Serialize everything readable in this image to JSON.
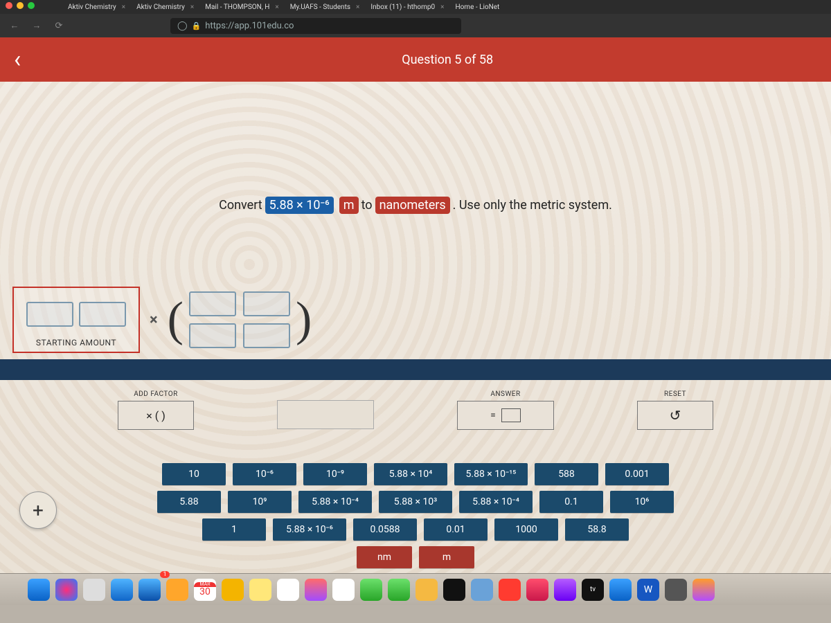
{
  "browser": {
    "tabs": [
      {
        "label": "Aktiv Chemistry"
      },
      {
        "label": "Aktiv Chemistry"
      },
      {
        "label": "Mail - THOMPSON, H"
      },
      {
        "label": "My.UAFS - Students"
      },
      {
        "label": "Inbox (11) - hthomp0"
      },
      {
        "label": "Home - LioNet"
      }
    ],
    "url": "https://app.101edu.co"
  },
  "header": {
    "question_counter": "Question 5 of 58"
  },
  "prompt": {
    "t1": "Convert",
    "value_chip": "5.88 × 10⁻⁶",
    "unit_from": "m",
    "t2": "to",
    "unit_to": "nanometers",
    "t3": ". Use only the metric system."
  },
  "work": {
    "starting_label": "STARTING AMOUNT"
  },
  "controls": {
    "add_factor_label": "ADD FACTOR",
    "add_factor_btn": "× (   )",
    "answer_label": "ANSWER",
    "answer_eq": "=",
    "reset_label": "RESET",
    "reset_icon": "↺"
  },
  "tiles": {
    "row1": [
      "10",
      "10⁻⁶",
      "10⁻⁹",
      "5.88 × 10⁴",
      "5.88 × 10⁻¹⁵",
      "588",
      "0.001"
    ],
    "row2": [
      "5.88",
      "10⁹",
      "5.88 × 10⁻⁴",
      "5.88 × 10³",
      "5.88 × 10⁻⁴",
      "0.1",
      "10⁶"
    ],
    "row3": [
      "1",
      "5.88 × 10⁻⁶",
      "0.0588",
      "0.01",
      "1000",
      "58.8"
    ],
    "units": [
      "nm",
      "m"
    ]
  },
  "fab": "+",
  "dock": {
    "cal_month": "MAR",
    "cal_day": "30",
    "tv": "tv",
    "word": "W",
    "mail_badge": "1"
  }
}
